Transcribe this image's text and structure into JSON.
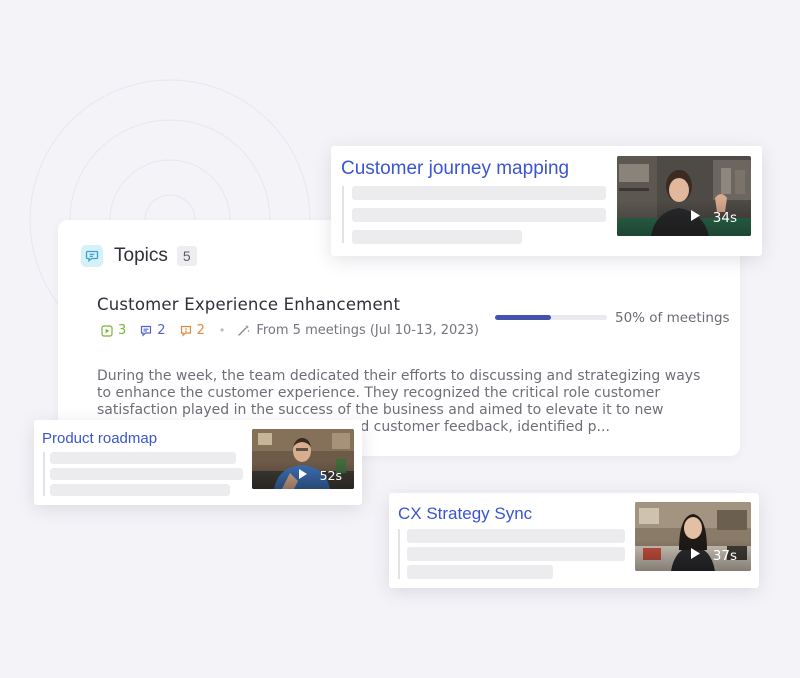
{
  "topics_panel": {
    "title": "Topics",
    "count": "5",
    "topic": {
      "name": "Customer Experience Enhancement",
      "stats": {
        "videos": "3",
        "comments": "2",
        "questions": "2"
      },
      "source": "From 5 meetings (Jul 10-13, 2023)",
      "meetings_fraction": 0.5,
      "meetings_label": "50% of meetings",
      "summary": "During the week, the team dedicated their efforts to discussing and strategizing ways to enhance the customer experience. They recognized the critical role customer satisfaction played in the success of the business and aimed to elevate it to new heights. To achieve this, they analyzed customer feedback, identified p..."
    }
  },
  "clips": [
    {
      "title": "Customer journey mapping",
      "duration": "34s"
    },
    {
      "title": "Product roadmap",
      "duration": "52s"
    },
    {
      "title": "CX Strategy Sync",
      "duration": "37s"
    }
  ],
  "colors": {
    "accent_link": "#3a55d0",
    "progress": "#4552ad",
    "video_stat": "#7bb338",
    "comment_stat": "#5264cc",
    "question_stat": "#e08a3a"
  },
  "icons": [
    "topics-icon",
    "video-stat-icon",
    "comment-stat-icon",
    "question-stat-icon",
    "sparkle-icon",
    "play-icon"
  ]
}
